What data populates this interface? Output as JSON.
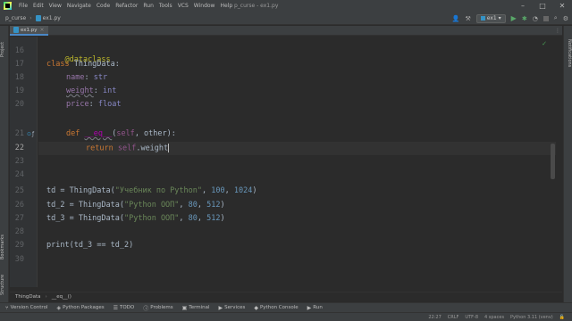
{
  "window": {
    "title": "p_curse - ex1.py",
    "menu": [
      "File",
      "Edit",
      "View",
      "Navigate",
      "Code",
      "Refactor",
      "Run",
      "Tools",
      "VCS",
      "Window",
      "Help"
    ]
  },
  "navbar": {
    "project": "p_curse",
    "file": "ex1.py",
    "run_config": "ex1"
  },
  "left_tabs": {
    "project": "Project",
    "bookmarks": "Bookmarks",
    "structure": "Structure"
  },
  "right_tabs": {
    "notifications": "Notifications"
  },
  "editor_tab": {
    "label": "ex1.py"
  },
  "code": {
    "line_numbers": [
      "16",
      "17",
      "18",
      "19",
      "20",
      "21",
      "22",
      "23",
      "24",
      "25",
      "26",
      "27",
      "28",
      "29",
      "30"
    ],
    "current_line": "22",
    "lines": {
      "l16_deco": "@dataclass",
      "l17_kw": "class",
      "l17_name": " ThingData:",
      "l18_field": "name",
      "l18_colon": ": ",
      "l18_type": "str",
      "l19_field": "weight",
      "l19_colon": ": ",
      "l19_type": "int",
      "l20_field": "price",
      "l20_colon": ": ",
      "l20_type": "float",
      "l21_kw": "def",
      "l21_sp": " ",
      "l21_name": "__eq__",
      "l21_open": "(",
      "l21_self": "self",
      "l21_rest": ", other):",
      "l22_kw": "return",
      "l22_sp": " ",
      "l22_self": "self",
      "l22_attr": ".weight",
      "l25_a": "td = ThingData(",
      "l25_str": "\"Учебник по Python\"",
      "l25_sep1": ", ",
      "l25_n1": "100",
      "l25_sep2": ", ",
      "l25_n2": "1024",
      "l25_close": ")",
      "l26_a": "td_2 = ThingData(",
      "l26_str": "\"Python ООП\"",
      "l26_sep1": ", ",
      "l26_n1": "80",
      "l26_sep2": ", ",
      "l26_n2": "512",
      "l26_close": ")",
      "l27_a": "td_3 = ThingData(",
      "l27_str": "\"Python ООП\"",
      "l27_sep1": ", ",
      "l27_n1": "80",
      "l27_sep2": ", ",
      "l27_n2": "512",
      "l27_close": ")",
      "l29_a": "print(td_3 == td_2)"
    }
  },
  "code_breadcrumbs": [
    "ThingData",
    "__eq__()"
  ],
  "bottom_tools": [
    "Version Control",
    "Python Packages",
    "TODO",
    "Problems",
    "Terminal",
    "Services",
    "Python Console",
    "Run"
  ],
  "status": {
    "position": "22:27",
    "line_sep": "CRLF",
    "encoding": "UTF-8",
    "indent": "4 spaces",
    "interpreter": "Python 3.11 (venv)"
  }
}
